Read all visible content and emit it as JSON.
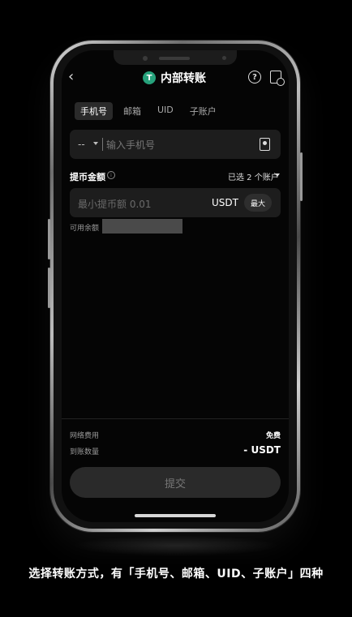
{
  "header": {
    "title": "内部转账",
    "token_symbol": "T",
    "back_icon": "chevron-left-icon",
    "help_icon": "help-icon",
    "history_icon": "history-icon"
  },
  "tabs": [
    {
      "label": "手机号",
      "active": true
    },
    {
      "label": "邮箱",
      "active": false
    },
    {
      "label": "UID",
      "active": false
    },
    {
      "label": "子账户",
      "active": false
    }
  ],
  "phone": {
    "country_code": "--",
    "placeholder": "输入手机号"
  },
  "amount": {
    "label": "提币金额",
    "account_select": "已选 2 个账户",
    "placeholder": "最小提币额 0.01",
    "currency": "USDT",
    "max_label": "最大"
  },
  "balance": {
    "label": "可用余额"
  },
  "fees": {
    "fee_label": "网络费用",
    "fee_value": "免费",
    "receive_label": "到账数量",
    "receive_value": "- USDT"
  },
  "submit_label": "提交",
  "caption": "选择转账方式，有「手机号、邮箱、UID、子账户」四种",
  "colors": {
    "tether_green": "#26a17b",
    "background": "#000000",
    "field_bg": "#1d1d1d"
  }
}
